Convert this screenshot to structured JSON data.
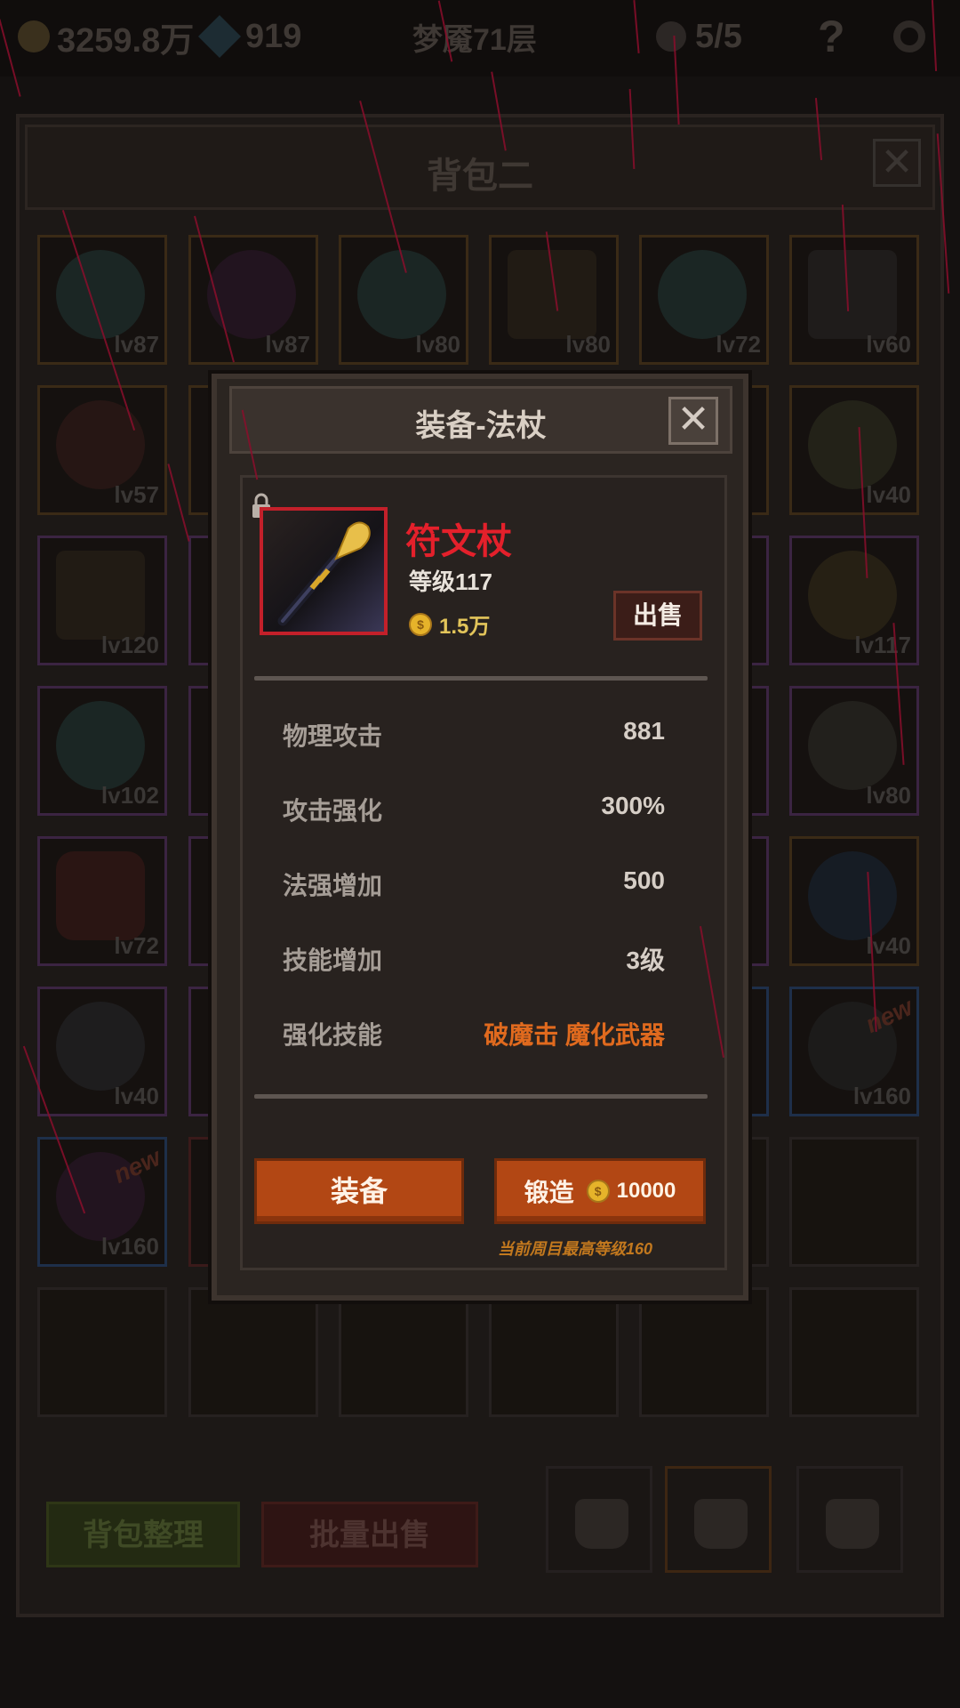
{
  "topbar": {
    "gold": "3259.8万",
    "gems": "919",
    "floor": "梦魇71层",
    "skulls": "5/5",
    "help": "?"
  },
  "bag": {
    "title": "背包二",
    "close": "✕",
    "row1_levels": [
      "lv87",
      "lv87",
      "lv80",
      "lv80",
      "lv72",
      "lv60"
    ],
    "col1_levels": [
      "lv57",
      "lv120",
      "lv102",
      "lv72",
      "lv40",
      "lv160"
    ],
    "col6_levels": [
      "lv40",
      "lv117",
      "lv80",
      "lv40",
      "lv160"
    ],
    "new_tag": "new",
    "sort_button": "背包整理",
    "bulk_sell_button": "批量出售"
  },
  "popup": {
    "title": "装备-法杖",
    "close": "✕",
    "item_name": "符文杖",
    "item_level": "等级117",
    "price": "1.5万",
    "coin_symbol": "$",
    "sell_button": "出售",
    "stats": [
      {
        "label": "物理攻击",
        "value": "881"
      },
      {
        "label": "攻击强化",
        "value": "300%"
      },
      {
        "label": "法强增加",
        "value": "500"
      },
      {
        "label": "技能增加",
        "value": "3级"
      },
      {
        "label": "强化技能",
        "value": "破魔击 魔化武器"
      }
    ],
    "equip_button": "装备",
    "forge_button": "锻造",
    "forge_cost": "10000",
    "max_note": "当前周目最高等级160"
  },
  "colors": {
    "item_name": "#e4202b",
    "accent_button": "#b24714",
    "skill_text": "#e06a1e",
    "rain": "#8a0e2c"
  }
}
